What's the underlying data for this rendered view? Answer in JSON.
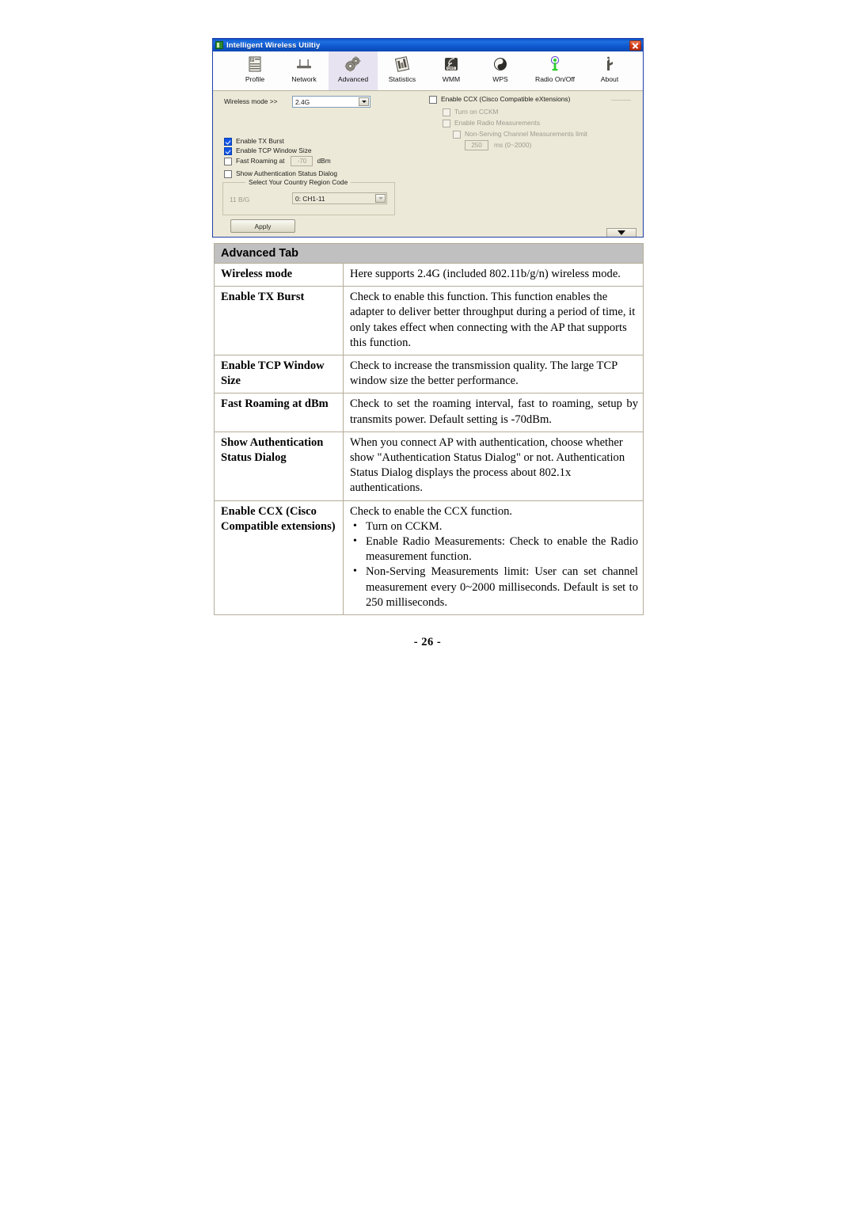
{
  "window": {
    "title": "Intelligent Wireless Utiltiy",
    "close_label": "Close",
    "toolbar": [
      {
        "label": "Profile",
        "icon": "profile-icon",
        "selected": false
      },
      {
        "label": "Network",
        "icon": "network-icon",
        "selected": false
      },
      {
        "label": "Advanced",
        "icon": "advanced-gears-icon",
        "selected": true
      },
      {
        "label": "Statistics",
        "icon": "statistics-icon",
        "selected": false
      },
      {
        "label": "WMM",
        "icon": "wmm-qos-icon",
        "selected": false
      },
      {
        "label": "WPS",
        "icon": "wps-icon",
        "selected": false
      },
      {
        "label": "Radio On/Off",
        "icon": "radio-onoff-icon",
        "selected": false
      },
      {
        "label": "About",
        "icon": "about-icon",
        "selected": false
      }
    ],
    "advanced_panel": {
      "wireless_mode_label": "Wireless mode >>",
      "wireless_mode_value": "2.4G",
      "enable_tx_burst": "Enable TX Burst",
      "enable_tcp_window_size": "Enable TCP Window Size",
      "fast_roaming_at": "Fast Roaming at",
      "fast_roaming_value": "-70",
      "fast_roaming_unit": "dBm",
      "show_auth_status_dialog": "Show Authentication Status Dialog",
      "country_group_title": "Select Your Country Region Code",
      "band_label": "11 B/G",
      "region_value": "0: CH1-11",
      "apply_label": "Apply"
    },
    "ccx_panel": {
      "enable_ccx": "Enable CCX (Cisco Compatible eXtensions)",
      "turn_on_cckm": "Turn on CCKM",
      "enable_radio_measurements": "Enable Radio Measurements",
      "non_serving_limit": "Non-Serving Channel Measurements limit",
      "limit_value": "250",
      "limit_unit": "ms (0~2000)"
    }
  },
  "table": {
    "header": "Advanced Tab",
    "rows": [
      {
        "term": "Wireless mode",
        "desc": "Here supports 2.4G (included 802.11b/g/n) wireless mode."
      },
      {
        "term": "Enable TX Burst",
        "desc": "Check to enable this function. This function enables the adapter to deliver better throughput during a period of time, it only takes effect when connecting with the AP that supports this function."
      },
      {
        "term": "Enable TCP Window Size",
        "desc": "Check to increase the transmission quality. The large TCP window size the better performance."
      },
      {
        "term": "Fast Roaming at dBm",
        "desc": "Check to set the roaming interval, fast to roaming, setup by transmits power. Default setting is -70dBm."
      },
      {
        "term": "Show Authentication Status Dialog",
        "desc": "When you connect AP with authentication, choose whether show \"Authentication Status Dialog\" or not. Authentication Status Dialog displays the process about 802.1x authentications."
      },
      {
        "term": "Enable CCX (Cisco Compatible extensions)",
        "desc": "Check to enable the CCX function.",
        "bullets": [
          "Turn on CCKM.",
          "Enable Radio Measurements: Check to enable the Radio measurement function.",
          "Non-Serving Measurements limit: User can set channel measurement every 0~2000 milliseconds. Default is set to 250 milliseconds."
        ]
      }
    ]
  },
  "page_number": "- 26 -"
}
